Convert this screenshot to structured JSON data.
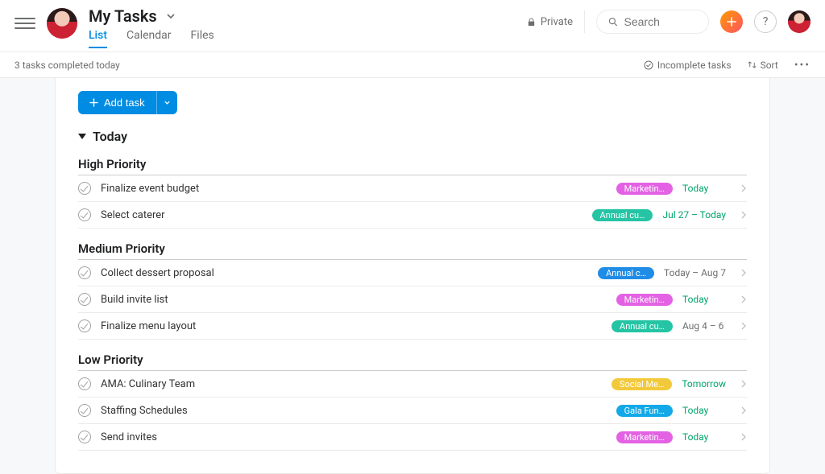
{
  "header": {
    "title": "My Tasks",
    "tabs": [
      "List",
      "Calendar",
      "Files"
    ],
    "active_tab": 0,
    "private_label": "Private",
    "search_placeholder": "Search"
  },
  "subbar": {
    "left_text": "3 tasks completed today",
    "incomplete_label": "Incomplete tasks",
    "sort_label": "Sort"
  },
  "add_task_label": "Add task",
  "section_today_label": "Today",
  "groups": [
    {
      "title": "High Priority",
      "tasks": [
        {
          "name": "Finalize event budget",
          "tag": {
            "label": "Marketin…",
            "color": "#e362e3"
          },
          "due": "Today",
          "due_style": "green"
        },
        {
          "name": "Select caterer",
          "tag": {
            "label": "Annual cu…",
            "color": "#25c4a4"
          },
          "due": "Jul 27 – Today",
          "due_style": "green"
        }
      ]
    },
    {
      "title": "Medium Priority",
      "tasks": [
        {
          "name": "Collect dessert proposal",
          "tag": {
            "label": "Annual c…",
            "color": "#1f8ce6"
          },
          "due": "Today – Aug 7",
          "due_style": "gray"
        },
        {
          "name": "Build invite list",
          "tag": {
            "label": "Marketin…",
            "color": "#e362e3"
          },
          "due": "Today",
          "due_style": "green"
        },
        {
          "name": "Finalize menu layout",
          "tag": {
            "label": "Annual cu…",
            "color": "#25c4a4"
          },
          "due": "Aug 4 – 6",
          "due_style": "gray"
        }
      ]
    },
    {
      "title": "Low Priority",
      "tasks": [
        {
          "name": "AMA: Culinary Team",
          "tag": {
            "label": "Social Me…",
            "color": "#f2c93b"
          },
          "due": "Tomorrow",
          "due_style": "green"
        },
        {
          "name": "Staffing Schedules",
          "tag": {
            "label": "Gala Fun…",
            "color": "#13a9e8"
          },
          "due": "Today",
          "due_style": "green"
        },
        {
          "name": "Send invites",
          "tag": {
            "label": "Marketin…",
            "color": "#e362e3"
          },
          "due": "Today",
          "due_style": "green"
        }
      ]
    }
  ],
  "colors": {
    "accent": "#008ce3"
  }
}
